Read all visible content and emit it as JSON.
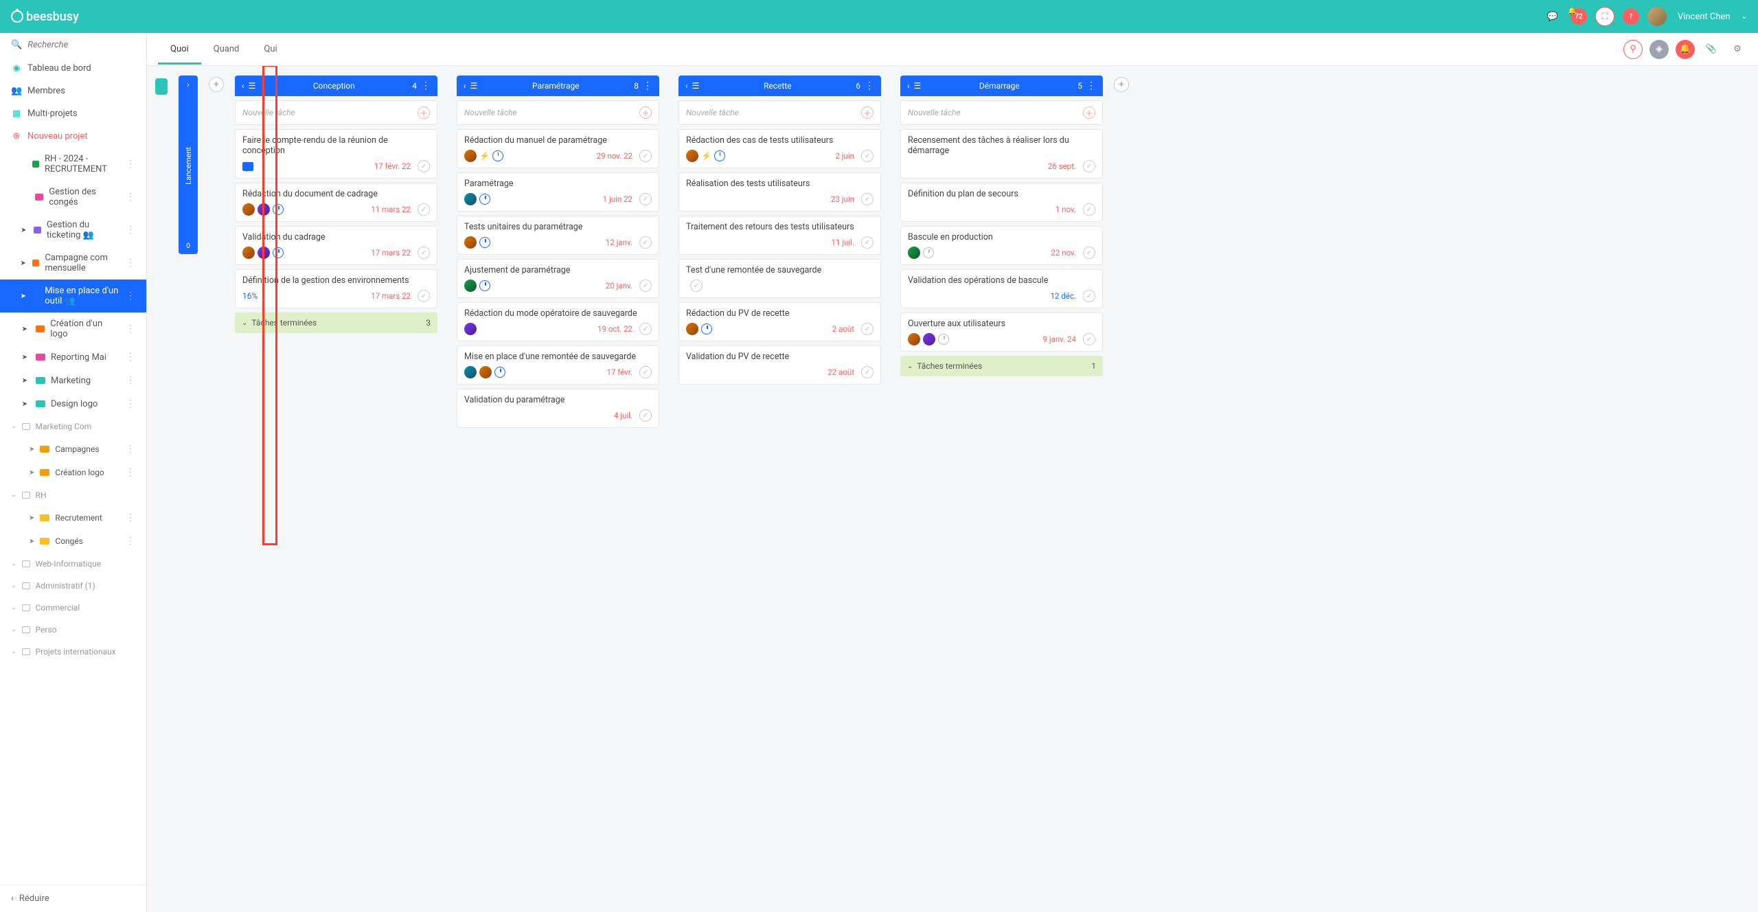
{
  "header": {
    "brand": "beesbusy",
    "notif_count": "72",
    "user_name": "Vincent Chen"
  },
  "sidebar": {
    "search_placeholder": "Recherche",
    "dashboard": "Tableau de bord",
    "members": "Membres",
    "multi_projects": "Multi-projets",
    "new_project": "Nouveau projet",
    "projects": [
      {
        "name": "RH - 2024 - RECRUTEMENT",
        "color": "#16a34a"
      },
      {
        "name": "Gestion des congés",
        "color": "#ec4899"
      },
      {
        "name": "Gestion du ticketing 👥",
        "color": "#8b5cf6",
        "arrow": true
      },
      {
        "name": "Campagne com mensuelle",
        "color": "#f97316",
        "arrow": true
      },
      {
        "name": "Mise en place d'un outil 👥",
        "color": "#1968ff",
        "arrow": true,
        "active": true
      },
      {
        "name": "Création d'un logo",
        "color": "#f97316",
        "arrow": true
      },
      {
        "name": "Reporting Mai",
        "color": "#ec4899",
        "arrow": true
      },
      {
        "name": "Marketing",
        "color": "#2bc4b9",
        "arrow": true
      },
      {
        "name": "Design logo",
        "color": "#2bc4b9",
        "arrow": true
      }
    ],
    "groups": [
      {
        "name": "Marketing Com",
        "sub": [
          {
            "name": "Campagnes",
            "color": "#f59e0b"
          },
          {
            "name": "Création logo",
            "color": "#f59e0b"
          }
        ]
      },
      {
        "name": "RH",
        "sub": [
          {
            "name": "Recrutement",
            "color": "#fbbf24"
          },
          {
            "name": "Congés",
            "color": "#fbbf24"
          }
        ]
      },
      {
        "name": "Web-Informatique"
      },
      {
        "name": "Administratif (1)"
      },
      {
        "name": "Commercial"
      },
      {
        "name": "Perso"
      },
      {
        "name": "Projets internationaux"
      }
    ],
    "reduce": "Réduire"
  },
  "tabs": {
    "quoi": "Quoi",
    "quand": "Quand",
    "qui": "Qui"
  },
  "collapsed_col": {
    "label": "Lancement",
    "count": "0"
  },
  "new_task_label": "Nouvelle tâche",
  "done_label": "Tâches terminées",
  "columns": [
    {
      "title": "Conception",
      "count": "4",
      "cards": [
        {
          "title": "Faire le compte-rendu de la réunion de conception",
          "date": "17 févr. 22",
          "icons": [
            "comment"
          ]
        },
        {
          "title": "Rédaction du document de cadrage",
          "date": "11 mars 22",
          "avatars": [
            "a1",
            "a2"
          ],
          "icons": [
            "clock"
          ]
        },
        {
          "title": "Validation du cadrage",
          "date": "17 mars 22",
          "avatars": [
            "a1",
            "a2"
          ],
          "icons": [
            "clock"
          ]
        },
        {
          "title": "Définition de la gestion des environnements",
          "date": "17 mars 22",
          "percent": "16%"
        }
      ],
      "done_count": "3"
    },
    {
      "title": "Paramétrage",
      "count": "8",
      "cards": [
        {
          "title": "Rédaction du manuel de paramétrage",
          "date": "29 nov. 22",
          "avatars": [
            "a1"
          ],
          "icons": [
            "bolt",
            "clock"
          ]
        },
        {
          "title": "Paramétrage",
          "date": "1 juin 22",
          "avatars": [
            "a3"
          ],
          "icons": [
            "clock"
          ]
        },
        {
          "title": "Tests unitaires du paramétrage",
          "date": "12 janv.",
          "avatars": [
            "a1"
          ],
          "icons": [
            "clock"
          ]
        },
        {
          "title": "Ajustement de paramétrage",
          "date": "20 janv.",
          "avatars": [
            "a4"
          ],
          "icons": [
            "clock"
          ]
        },
        {
          "title": "Rédaction du mode opératoire de sauvegarde",
          "date": "19 oct. 22",
          "avatars": [
            "a2"
          ]
        },
        {
          "title": "Mise en place d'une remontée de sauvegarde",
          "date": "17 févr.",
          "avatars": [
            "a3",
            "a1"
          ],
          "icons": [
            "clock"
          ]
        },
        {
          "title": "Validation du paramétrage",
          "date": "4 juil."
        }
      ]
    },
    {
      "title": "Recette",
      "count": "6",
      "cards": [
        {
          "title": "Rédaction des cas de tests utilisateurs",
          "date": "2 juin",
          "avatars": [
            "a1"
          ],
          "icons": [
            "bolt",
            "clock"
          ]
        },
        {
          "title": "Réalisation des tests utilisateurs",
          "date": "23 juin"
        },
        {
          "title": "Traitement des retours des tests utilisateurs",
          "date": "11 juil."
        },
        {
          "title": "Test d'une remontée de sauvegarde",
          "date": ""
        },
        {
          "title": "Rédaction du PV de recette",
          "date": "2 août",
          "avatars": [
            "a1"
          ],
          "icons": [
            "clock"
          ]
        },
        {
          "title": "Validation du PV de recette",
          "date": "22 août"
        }
      ]
    },
    {
      "title": "Démarrage",
      "count": "5",
      "cards": [
        {
          "title": "Recensement des tâches à réaliser lors du démarrage",
          "date": "26 sept."
        },
        {
          "title": "Définition du plan de secours",
          "date": "1 nov."
        },
        {
          "title": "Bascule en production",
          "date": "22 nov.",
          "avatars": [
            "a4"
          ],
          "icons": [
            "clock-gray"
          ]
        },
        {
          "title": "Validation des opérations de bascule",
          "date": "12 déc.",
          "dateBlue": true
        },
        {
          "title": "Ouverture aux utilisateurs",
          "date": "9 janv. 24",
          "avatars": [
            "a1",
            "a2"
          ],
          "icons": [
            "clock-gray"
          ]
        }
      ],
      "done_count": "1"
    }
  ]
}
